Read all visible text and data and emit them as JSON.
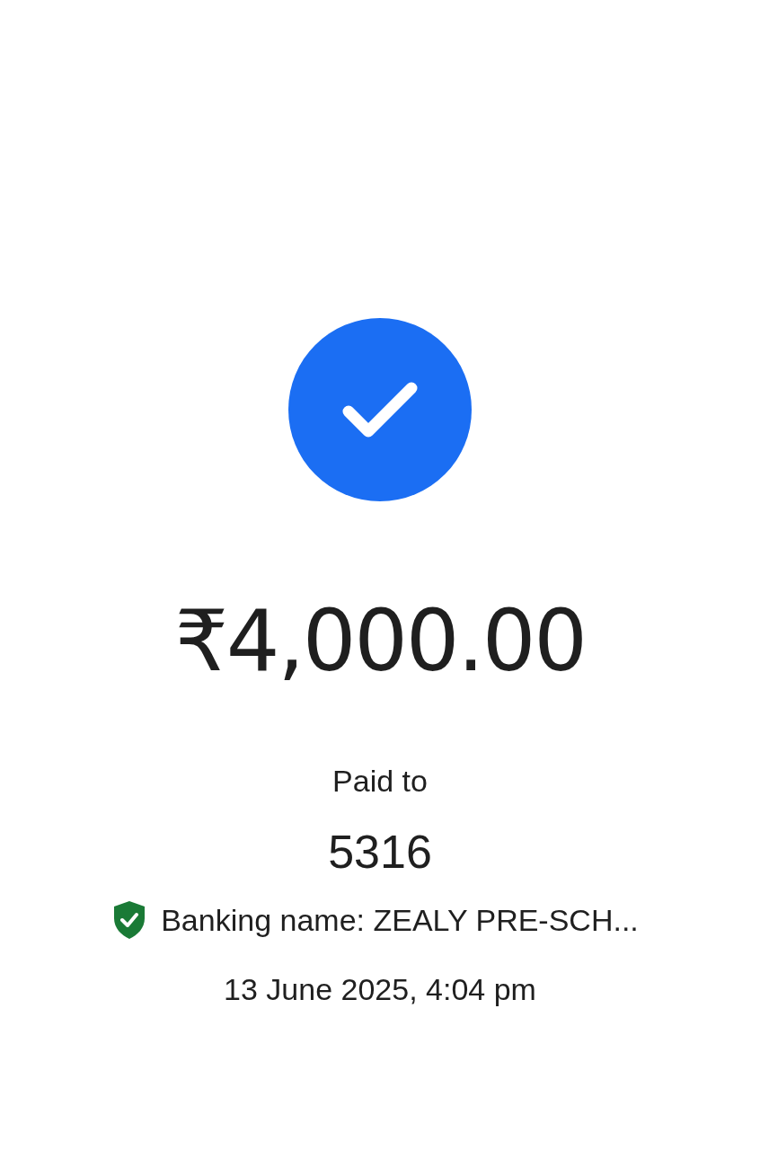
{
  "status": {
    "kind": "success"
  },
  "amount": "₹4,000.00",
  "paid_to_label": "Paid to",
  "payee": "5316",
  "banking_name": {
    "verified": true,
    "text": "Banking name: ZEALY PRE-SCH..."
  },
  "timestamp": "13 June 2025, 4:04 pm"
}
